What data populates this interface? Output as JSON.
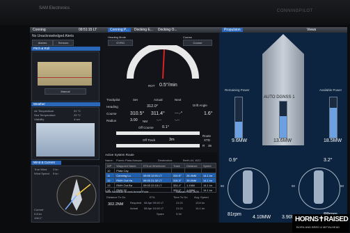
{
  "bezel": {
    "brand": "SAM Electronics",
    "brand_right": "CONNINGPILOT"
  },
  "top": {
    "app": "Conning",
    "time": "09:51:15 LT"
  },
  "alerts": {
    "text": "No Unacknowledged Alerts",
    "tabs": [
      "Alarms",
      "Sensors"
    ]
  },
  "left_panels": [
    {
      "title": "Pitch & Roll"
    },
    {
      "title": "Weather"
    },
    {
      "title": "Wind & Current"
    }
  ],
  "roll": {
    "label": "Manual"
  },
  "weather": {
    "air_temp_label": "Air Temperature",
    "air_temp": "31 °C",
    "sea_temp_label": "Sea Temperature",
    "sea_temp": "29 °C",
    "visibility_label": "Visibility",
    "visibility": "4 nm"
  },
  "wind": {
    "tws_label": "True Wind",
    "tws": "3 kn",
    "wind_label": "Wind Speed",
    "wind": "5 kn",
    "current_label": "Current",
    "current": "0.8 kn",
    "cur_dir": "106.1°"
  },
  "header_tabs": [
    "Conning P...",
    "Docking E...",
    "Docking O...",
    "Propulsion"
  ],
  "mode": {
    "label": "GYRO",
    "course_label": "Course",
    "course": "Course",
    "heading_label": "Heading Mode"
  },
  "rot": {
    "label": "ROT",
    "value": "0.5°/min"
  },
  "trackpilot": {
    "title": "Trackpilot",
    "set": "Set",
    "actual": "Actual",
    "next": "Next",
    "heading_label": "Heading",
    "heading_set": "312.0°",
    "course_label": "Course",
    "course_set": "310.5°",
    "course_actual": "311.4°",
    "course_next": "---.-°",
    "radius_label": "Radius",
    "radius_set": "3.00",
    "radius_unit": "NM",
    "radius_actual": "-.--",
    "radius_next": "-.--",
    "drift_label": "Drift Angle",
    "drift": "1.6°"
  },
  "offcourse": {
    "label": "Off Course",
    "value": "0.1°"
  },
  "offtrack": {
    "label": "Off Track",
    "value": "3m",
    "route": "Route",
    "xtd": "XTD",
    "r": "R",
    "r_val": "36"
  },
  "route": {
    "title": "Active System Route",
    "name_label": "Name:",
    "name": "Puerto Plata-Nassau",
    "dest_label": "Destination:",
    "dest": "Berth #4, W22",
    "headers": [
      "WP",
      "Waypoint Name",
      "ETA at Wheelover",
      "Track",
      "Distance",
      "Speed"
    ],
    "rows": [
      [
        "10",
        "Plata Cay",
        "",
        "",
        "",
        ""
      ],
      [
        "11",
        "Conning Lu",
        "09:55 12:01 LT",
        "310.5°",
        "26.4NM",
        "14.1 kn"
      ],
      [
        "12",
        "RMH Out Ha",
        "09:00 21.32 LT",
        "316.3°",
        "39.0NM",
        "14.1 kn"
      ],
      [
        "13",
        "RMH Out Ba",
        "09:00 22:15 LT",
        "324.4°",
        "1.1NM",
        "14.1 kn"
      ],
      [
        "14",
        "RMH 32",
        "",
        "326.0°",
        "1.6NM",
        "14.1 kn"
      ]
    ]
  },
  "arrival": {
    "title": "Time Schedule to next Arrival Point",
    "point": "Nassau Pilot, W20",
    "dist_label": "Distance To Go",
    "eta_label": "ETA",
    "ttg_label": "Time To Go",
    "avg_label": "Avg. Speed",
    "dist": "302.2NM",
    "req_label": "Required",
    "req_eta": "08 Apr 09:00 LT",
    "req_ttg": "21:21",
    "req_spd": "13.6 kn",
    "act_label": "Actual",
    "act_eta": "08 Apr 10:00 LT",
    "act_ttg": "21:21",
    "act_spd": "14.1 kn",
    "spare_label": "Spare",
    "spare": "0:34"
  },
  "prop": {
    "remaining_label": "Remaining Power",
    "available_label": "Available Power",
    "autodgnss": "AUTO DGNSS 1",
    "rem": "9.6MW",
    "mid": "13.6MW",
    "avail": "18.5MW",
    "angle_l": "0.9°",
    "angle_r": "3.2°",
    "rpm": "81rpm",
    "pw_l": "4.10MW",
    "pw_r": "3.90MW",
    "rpm_r": "88rpm",
    "marks": [
      "90",
      "180",
      "270"
    ]
  },
  "views_label": "Views",
  "logo": {
    "line1": "HORNS✝RAISED",
    "line2": "BORN AND BRED & METALHEAD"
  },
  "colors": {
    "accent": "#2a67b8",
    "bg": "#0e1a28",
    "ship": "#c9d0d8"
  }
}
